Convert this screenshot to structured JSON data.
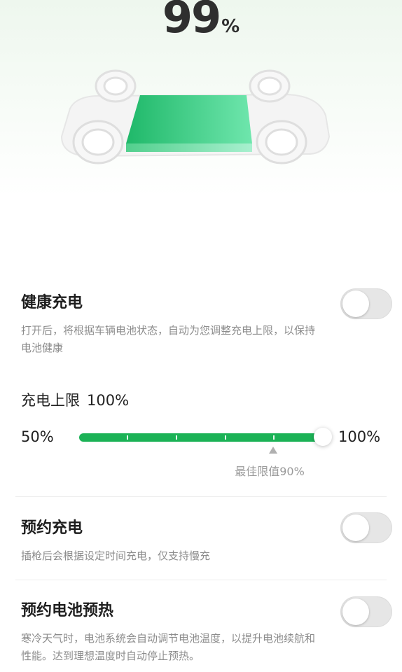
{
  "battery": {
    "value": "99",
    "unit": "%"
  },
  "health_charging": {
    "title": "健康充电",
    "description": "打开后，将根据车辆电池状态，自动为您调整充电上限，以保持电池健康",
    "enabled": false
  },
  "charge_limit": {
    "label": "充电上限",
    "value_text": "100%",
    "min_label": "50%",
    "max_label": "100%",
    "value": 100,
    "min": 50,
    "max": 100,
    "best_label": "最佳限值90%",
    "best_value": 90,
    "track_color": "#1bb256"
  },
  "scheduled_charging": {
    "title": "预约充电",
    "description": "插枪后会根据设定时间充电，仅支持慢充",
    "enabled": false
  },
  "battery_preheat": {
    "title": "预约电池预热",
    "description": "寒冷天气时，电池系统会自动调节电池温度，以提升电池续航和性能。达到理想温度时自动停止预热。",
    "enabled": false
  }
}
